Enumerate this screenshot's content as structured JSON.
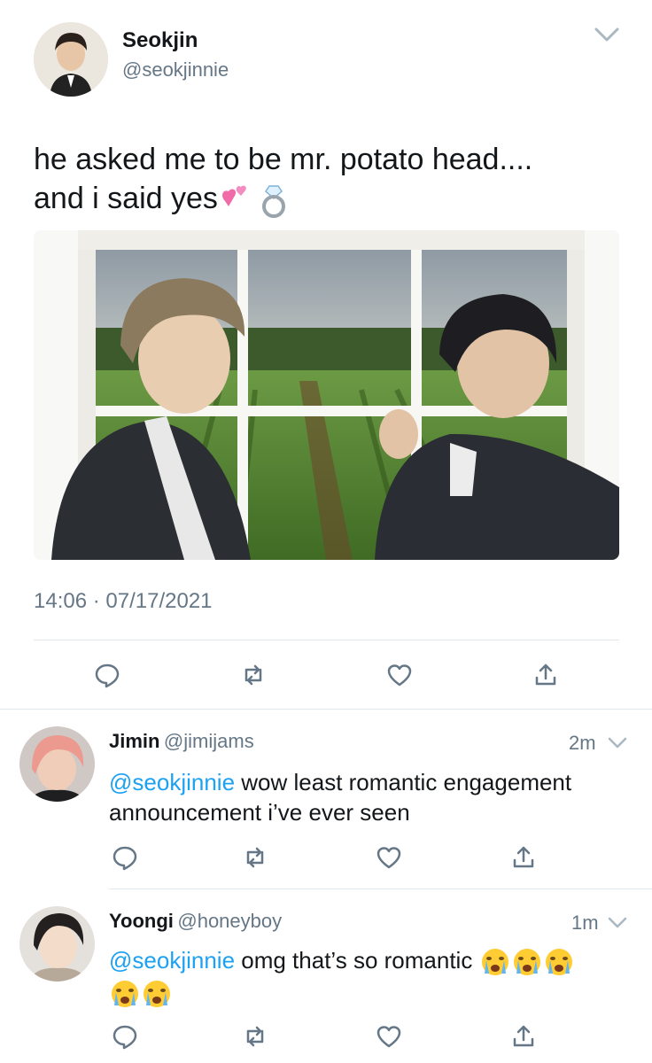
{
  "main_tweet": {
    "name": "Seokjin",
    "handle": "@seokjinnie",
    "text_line1": "he asked me to be mr. potato head....",
    "text_line2": "and i said yes",
    "time": "14:06",
    "separator": "·",
    "date": "07/17/2021"
  },
  "replies": [
    {
      "name": "Jimin",
      "handle": "@jimijams",
      "time": "2m",
      "mention": "@seokjinnie",
      "text": " wow least romantic engagement announcement i’ve ever seen"
    },
    {
      "name": "Yoongi",
      "handle": "@honeyboy",
      "time": "1m",
      "mention": "@seokjinnie",
      "text": " omg that’s so romantic"
    }
  ],
  "icons": {
    "reply": "speech-bubble",
    "retweet": "retweet-arrows",
    "like": "heart",
    "share": "share-upload",
    "caret": "chevron-down"
  },
  "colors": {
    "link": "#1da1f2",
    "secondary": "#657786",
    "divider": "#e1e8ed"
  }
}
